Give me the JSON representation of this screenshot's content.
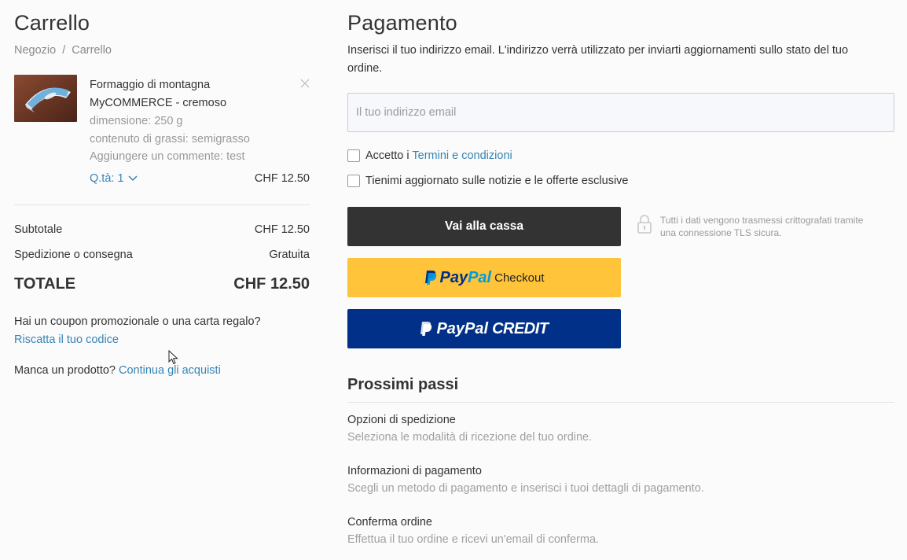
{
  "cart": {
    "title": "Carrello",
    "breadcrumb": [
      "Negozio",
      "/",
      "Carrello"
    ],
    "item": {
      "name_line1": "Formaggio di montagna",
      "name_line2": "MyCOMMERCE - cremoso",
      "attributes": [
        "dimensione: 250 g",
        "contenuto di grassi: semigrasso",
        "Aggiungere un commente: test"
      ],
      "qty_label": "Q.tà: 1",
      "price": "CHF 12.50"
    },
    "subtotal_label": "Subtotale",
    "subtotal_value": "CHF 12.50",
    "shipping_label": "Spedizione o consegna",
    "shipping_value": "Gratuita",
    "total_label": "TOTALE",
    "total_value": "CHF 12.50",
    "coupon_text": "Hai un coupon promozionale o una carta regalo?",
    "coupon_link": "Riscatta il tuo codice",
    "missing_text": "Manca un prodotto?",
    "missing_link": "Continua gli acquisti"
  },
  "payment": {
    "title": "Pagamento",
    "intro": "Inserisci il tuo indirizzo email. L'indirizzo verrà utilizzato per inviarti aggiornamenti sullo stato del tuo ordine.",
    "email_placeholder": "Il tuo indirizzo email",
    "email_value": "",
    "terms_prefix": "Accetto i",
    "terms_link": "Termini e condizioni",
    "newsletter_label": "Tienimi aggiornato sulle notizie e le offerte esclusive",
    "checkout_button": "Vai alla cassa",
    "secure_text": "Tutti i dati vengono trasmessi crittografati tramite una connessione TLS sicura.",
    "paypal_pay": "Pay",
    "paypal_pal": "Pal",
    "paypal_checkout": "Checkout",
    "paypal_credit": "CREDIT"
  },
  "next_steps": {
    "title": "Prossimi passi",
    "steps": [
      {
        "title": "Opzioni di spedizione",
        "desc": "Seleziona le modalità di ricezione del tuo ordine."
      },
      {
        "title": "Informazioni di pagamento",
        "desc": "Scegli un metodo di pagamento e inserisci i tuoi dettagli di pagamento."
      },
      {
        "title": "Conferma ordine",
        "desc": "Effettua il tuo ordine e ricevi un'email di conferma."
      }
    ]
  },
  "colors": {
    "link": "#3584b5",
    "dark_button": "#333333",
    "paypal_yellow": "#ffc439",
    "paypal_navy": "#003087",
    "paypal_light_blue": "#009cde"
  },
  "icons": [
    "close-icon",
    "chevron-down-icon",
    "lock-icon",
    "paypal-logo-icon",
    "mouse-cursor-icon"
  ]
}
